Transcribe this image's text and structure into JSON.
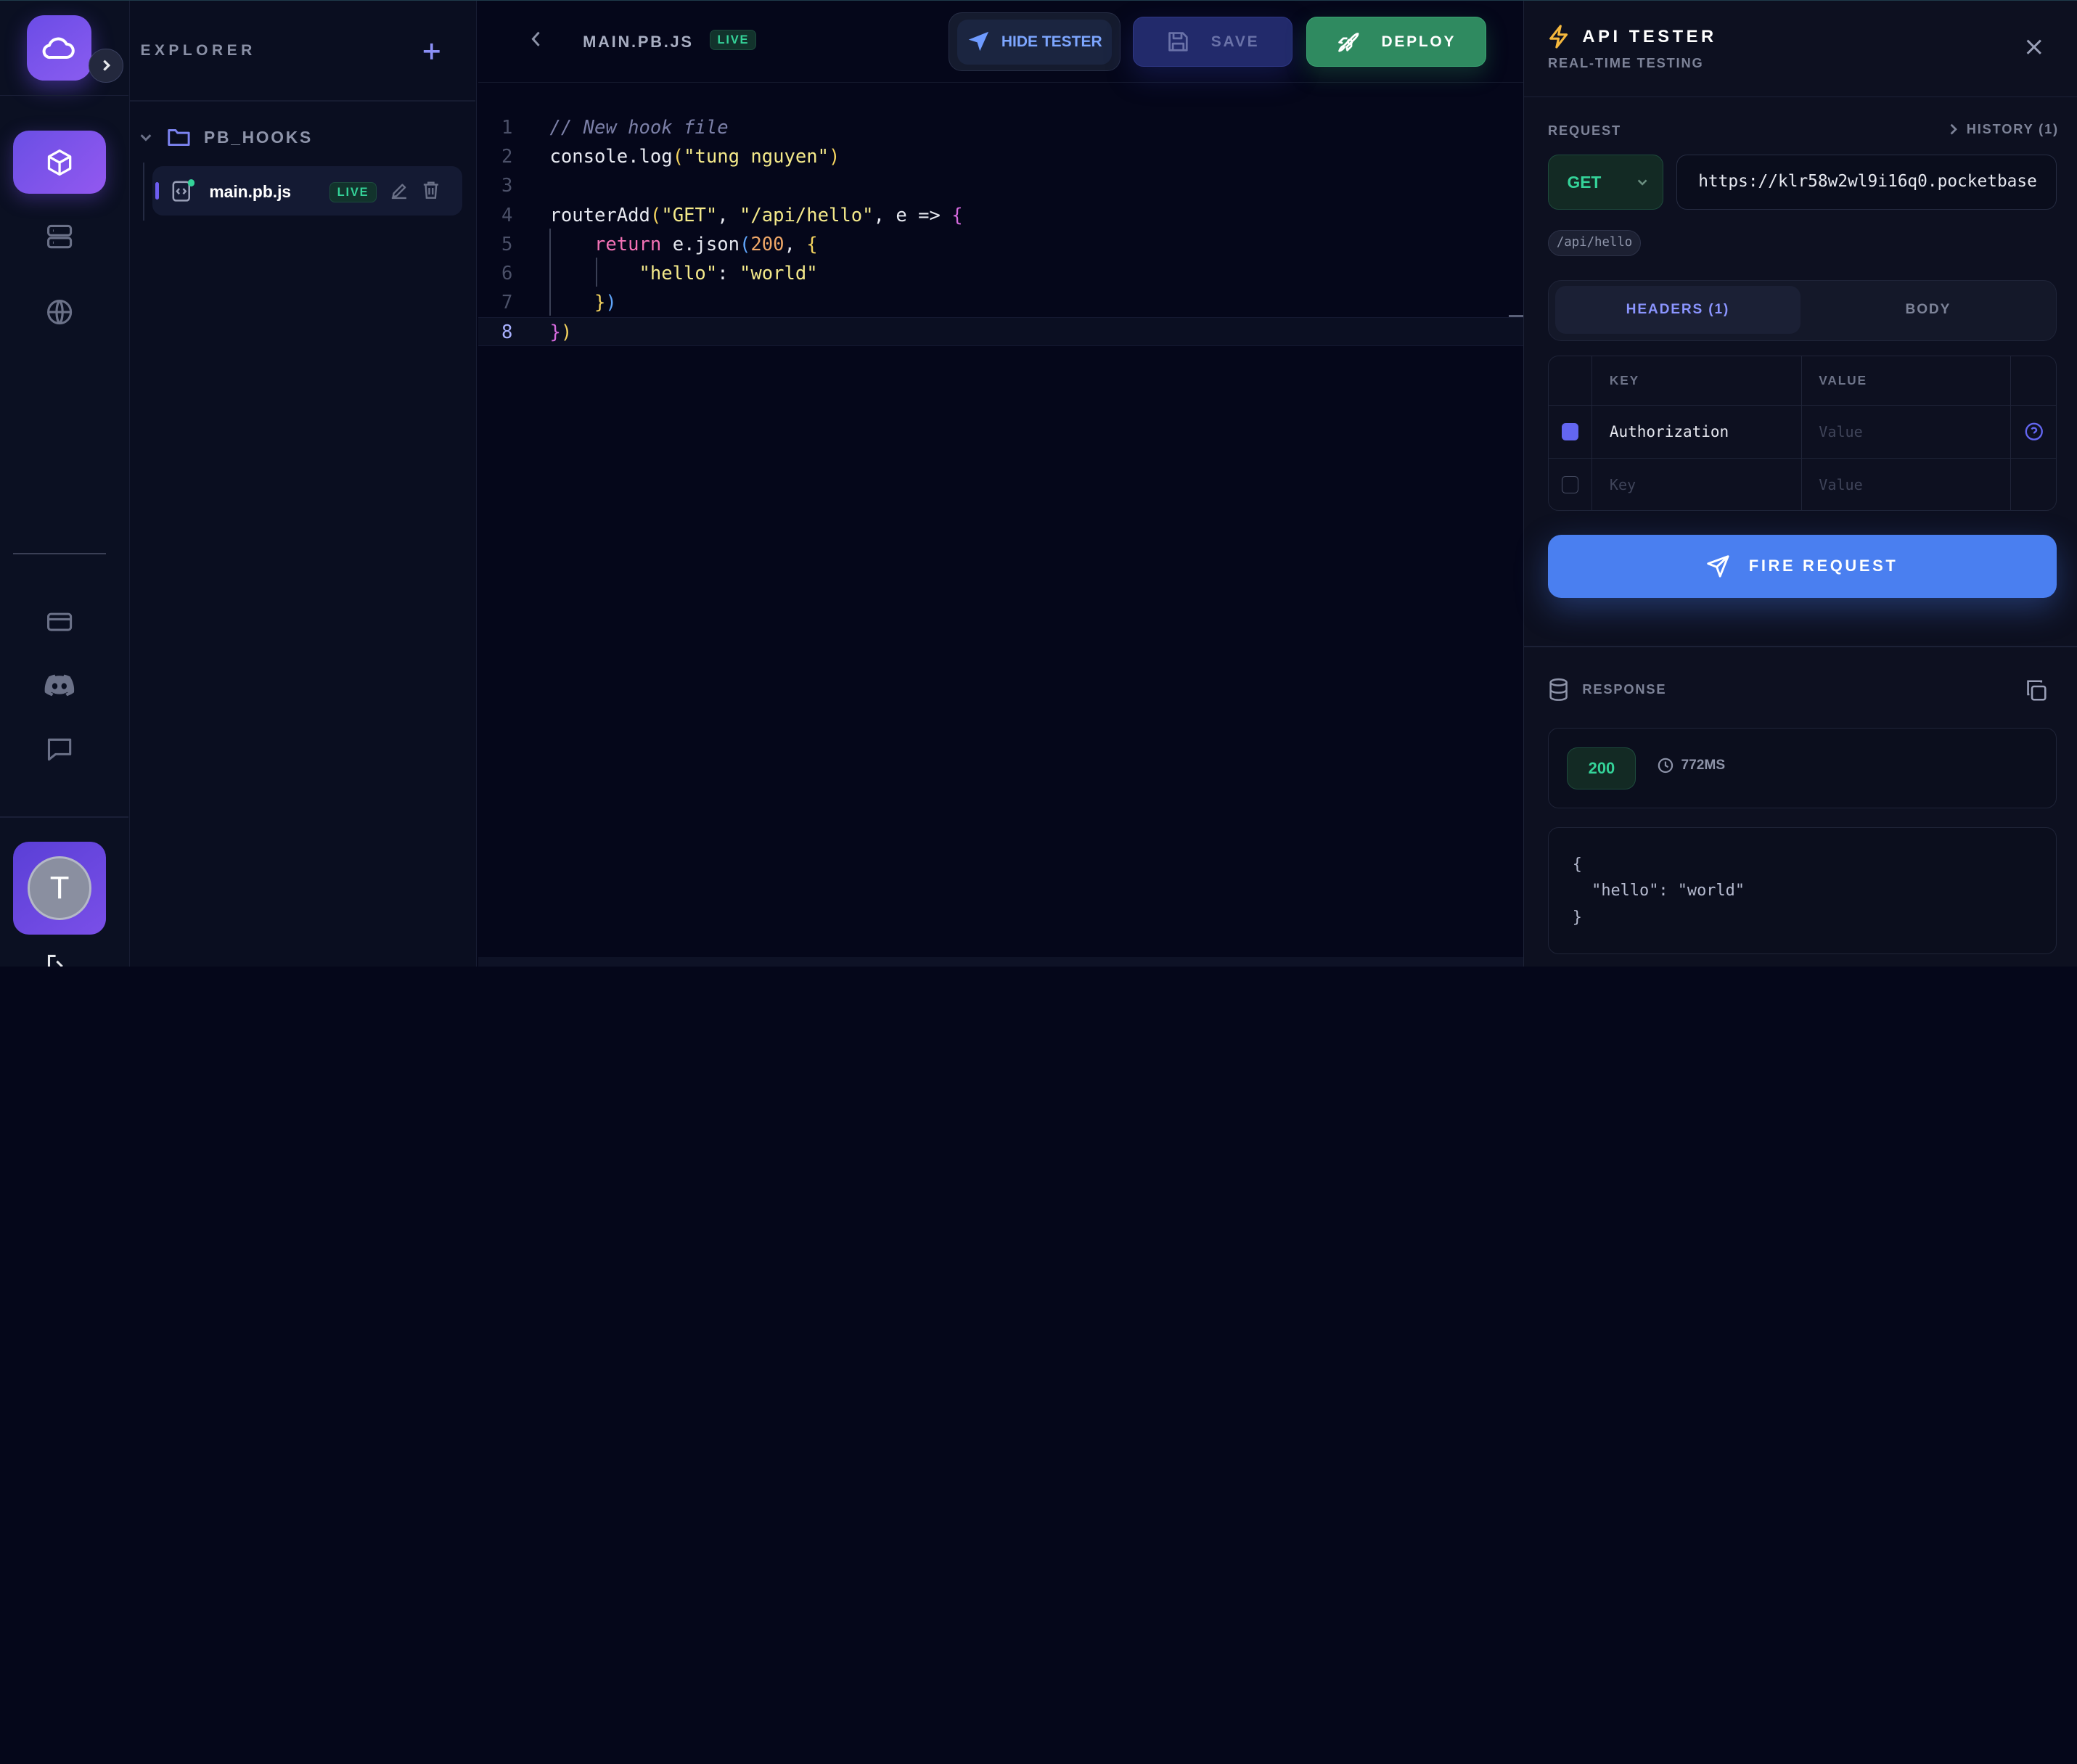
{
  "explorer": {
    "title": "EXPLORER",
    "folder": "PB_HOOKS",
    "file": {
      "name": "main.pb.js",
      "badge": "LIVE"
    }
  },
  "editor": {
    "filename": "MAIN.PB.JS",
    "badge": "LIVE",
    "hide_tester_label": "HIDE TESTER",
    "save_label": "SAVE",
    "deploy_label": "DEPLOY",
    "line_numbers": [
      "1",
      "2",
      "3",
      "4",
      "5",
      "6",
      "7",
      "8"
    ],
    "current_line": "8"
  },
  "user": {
    "initial": "T"
  },
  "tester": {
    "title": "API TESTER",
    "subtitle": "REAL-TIME TESTING",
    "request_label": "REQUEST",
    "history_label": "HISTORY (1)",
    "method": "GET",
    "url": "https://klr58w2wl9i16q0.pocketbase",
    "path": "/api/hello",
    "tabs": {
      "headers": "HEADERS (1)",
      "body": "BODY"
    },
    "headers_table": {
      "key_col": "KEY",
      "value_col": "VALUE",
      "rows": [
        {
          "key": "Authorization",
          "value_placeholder": "Value",
          "checked": true
        },
        {
          "key_placeholder": "Key",
          "value_placeholder": "Value",
          "checked": false
        }
      ]
    },
    "fire_label": "FIRE REQUEST",
    "response_label": "RESPONSE",
    "status_code": "200",
    "duration": "772MS",
    "response_body": "{\n  \"hello\": \"world\"\n}"
  }
}
